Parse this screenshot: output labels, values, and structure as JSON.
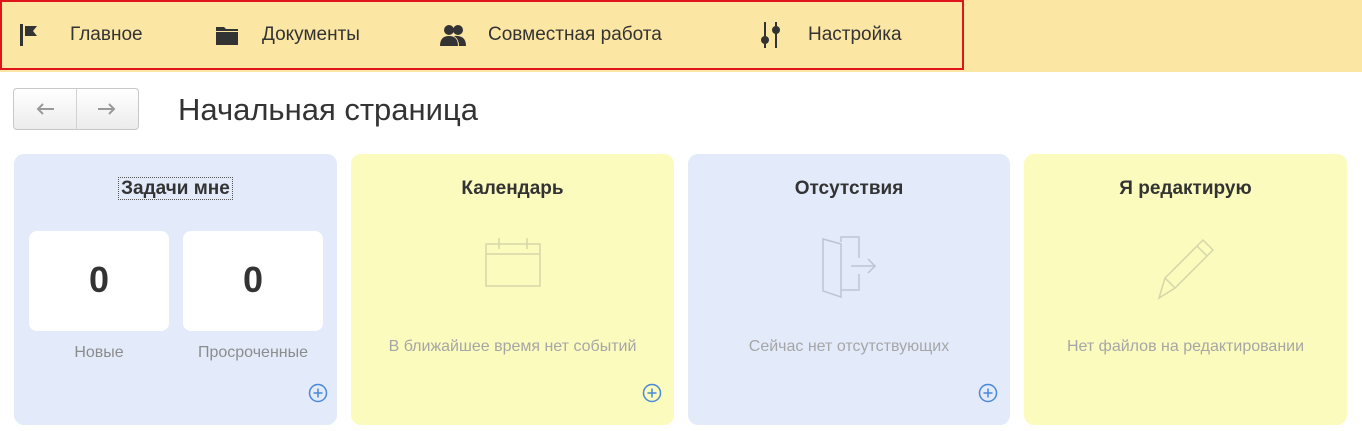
{
  "nav": {
    "items": [
      {
        "label": "Главное",
        "icon": "flag-icon"
      },
      {
        "label": "Документы",
        "icon": "folder-icon"
      },
      {
        "label": "Совместная работа",
        "icon": "users-icon"
      },
      {
        "label": "Настройка",
        "icon": "settings-sliders-icon"
      }
    ],
    "highlight_color": "#e0151b",
    "background": "#fbe6a3"
  },
  "history": {
    "back_icon": "arrow-left-icon",
    "forward_icon": "arrow-right-icon"
  },
  "page_title": "Начальная страница",
  "cards": {
    "tasks": {
      "title": "Задачи мне",
      "new_count": "0",
      "new_label": "Новые",
      "overdue_count": "0",
      "overdue_label": "Просроченные"
    },
    "calendar": {
      "title": "Календарь",
      "empty_text": "В ближайшее время нет событий",
      "icon": "calendar-icon"
    },
    "absences": {
      "title": "Отсутствия",
      "empty_text": "Сейчас нет отсутствующих",
      "icon": "door-exit-icon"
    },
    "editing": {
      "title": "Я редактирую",
      "empty_text": "Нет файлов на редактировании",
      "icon": "pencil-icon"
    }
  },
  "colors": {
    "card_blue": "#e3ebfb",
    "card_yellow": "#fbfbbe",
    "accent_icon": "#4a88d8"
  }
}
